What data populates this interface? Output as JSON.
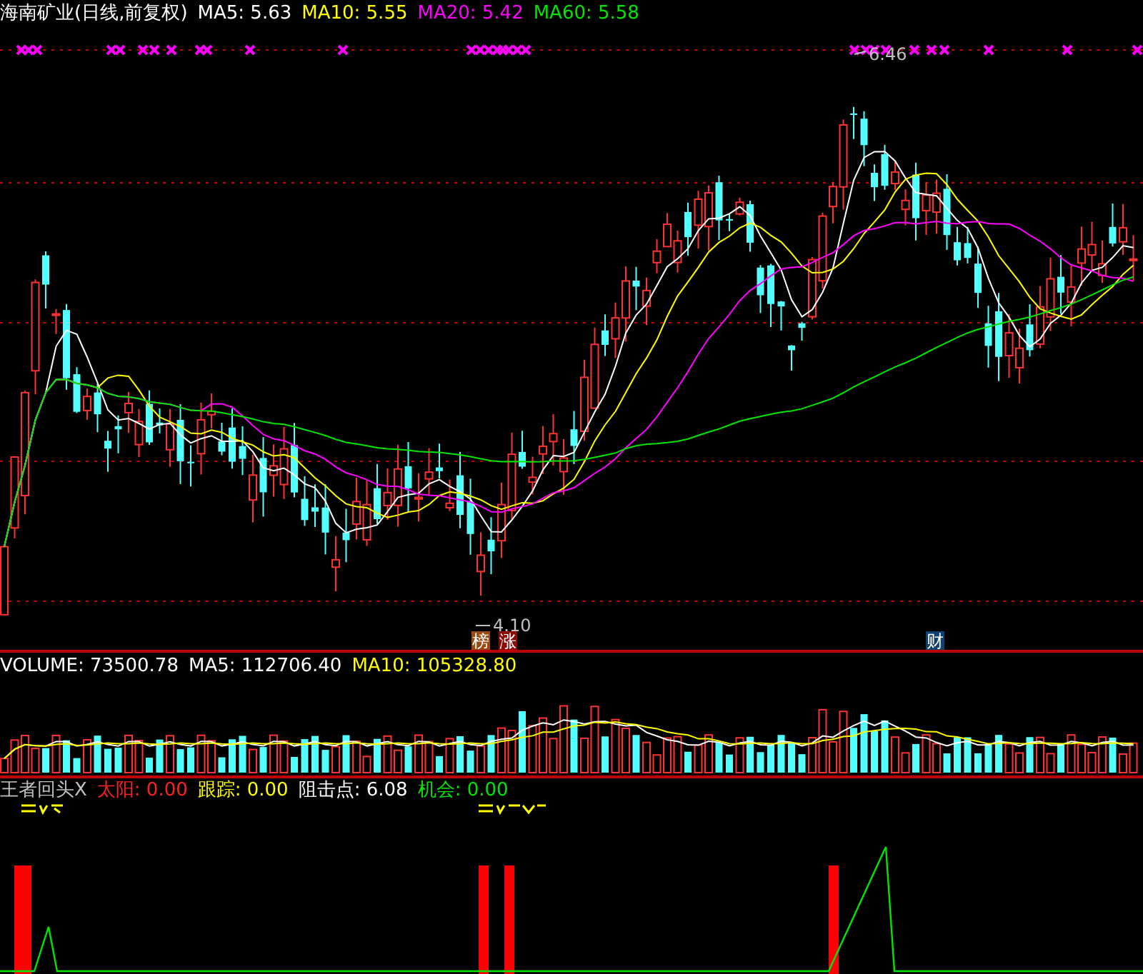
{
  "header": {
    "title": "海南矿业(日线,前复权)",
    "indicators": [
      {
        "label": "MA5: 5.63",
        "color": "#ffffff"
      },
      {
        "label": "MA10: 5.55",
        "color": "#ffff00"
      },
      {
        "label": "MA20: 5.42",
        "color": "#ff00ff"
      },
      {
        "label": "MA60: 5.58",
        "color": "#00e600"
      }
    ]
  },
  "price_chart": {
    "high_label": "6.46",
    "low_label": "4.10",
    "badges": [
      {
        "text": "榜",
        "color": "#9a4a10"
      },
      {
        "text": "涨",
        "color": "#8b0a0a"
      },
      {
        "text": "财",
        "color": "#12406e"
      }
    ]
  },
  "volume": {
    "items": [
      {
        "label": "VOLUME: 73500.78",
        "color": "#ffffff"
      },
      {
        "label": "MA5: 112706.40",
        "color": "#ffffff"
      },
      {
        "label": "MA10: 105328.80",
        "color": "#ffff00"
      }
    ]
  },
  "indicator": {
    "items": [
      {
        "label": "王者回头X",
        "color": "#c0c0c0"
      },
      {
        "label": "太阳: 0.00",
        "color": "#ff2020"
      },
      {
        "label": "跟踪: 0.00",
        "color": "#ffff00"
      },
      {
        "label": "阻击点: 6.08",
        "color": "#ffffff"
      },
      {
        "label": "机会: 0.00",
        "color": "#00e600"
      }
    ]
  }
}
